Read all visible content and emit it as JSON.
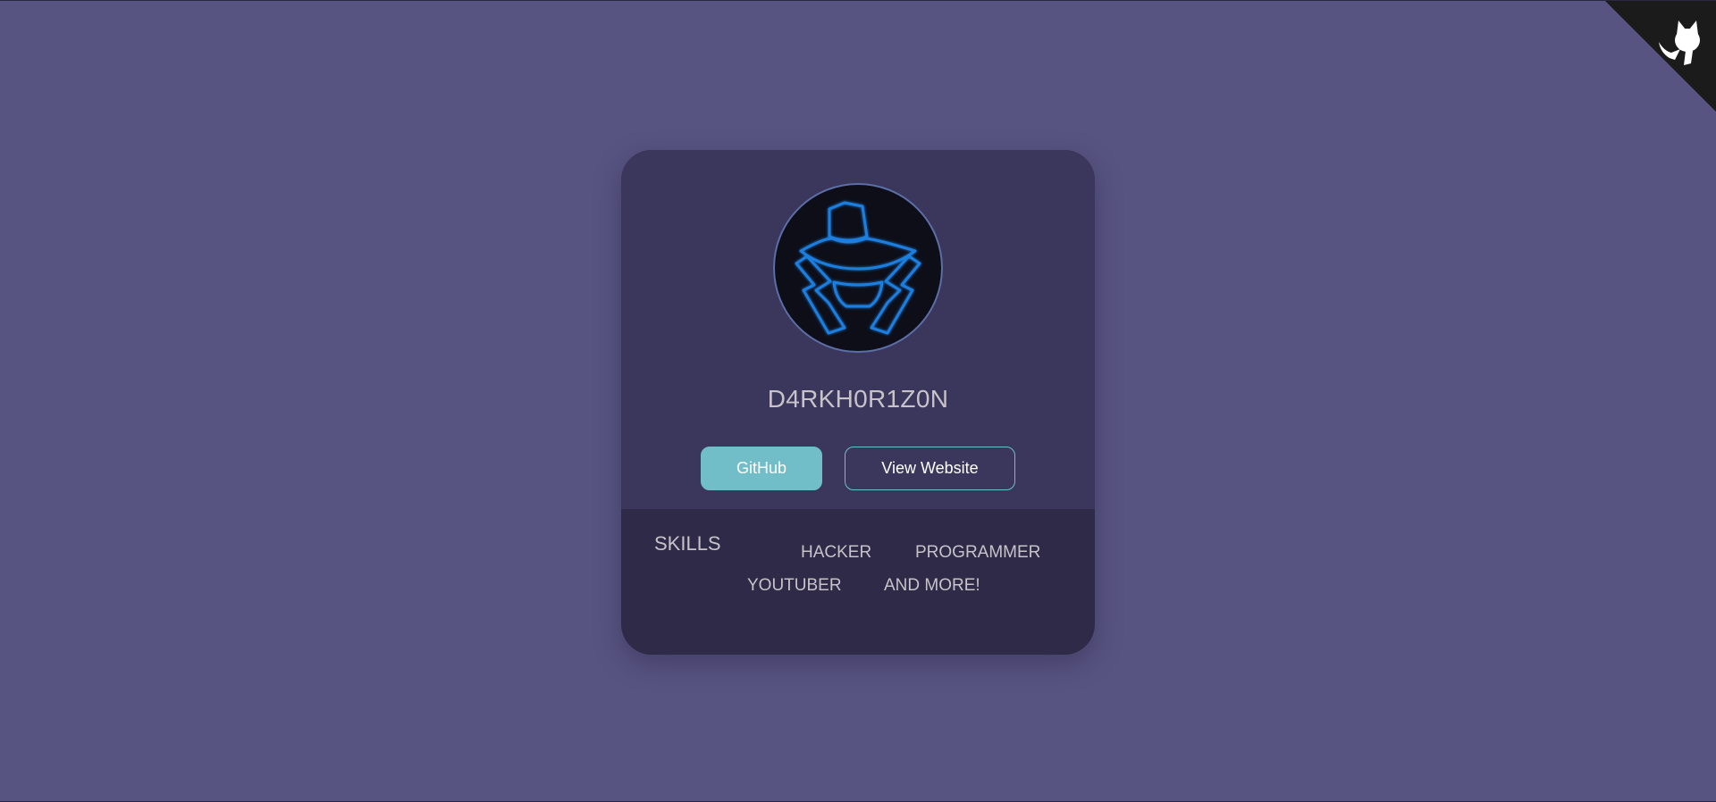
{
  "profile": {
    "name": "D4RKH0R1Z0N",
    "avatar_icon": "hooded-hacker-icon"
  },
  "buttons": {
    "github_label": "GitHub",
    "website_label": "View Website"
  },
  "skills": {
    "title": "SKILLS",
    "items": [
      "HACKER",
      "PROGRAMMER",
      "YOUTUBER",
      "AND MORE!"
    ]
  },
  "corner": {
    "icon": "github-octocat-icon"
  },
  "colors": {
    "background": "#585482",
    "card_top": "#3a365c",
    "card_bottom": "#2e2a48",
    "accent": "#72bec8",
    "text": "#c7c3c8",
    "neon_blue": "#1e7fe0"
  }
}
